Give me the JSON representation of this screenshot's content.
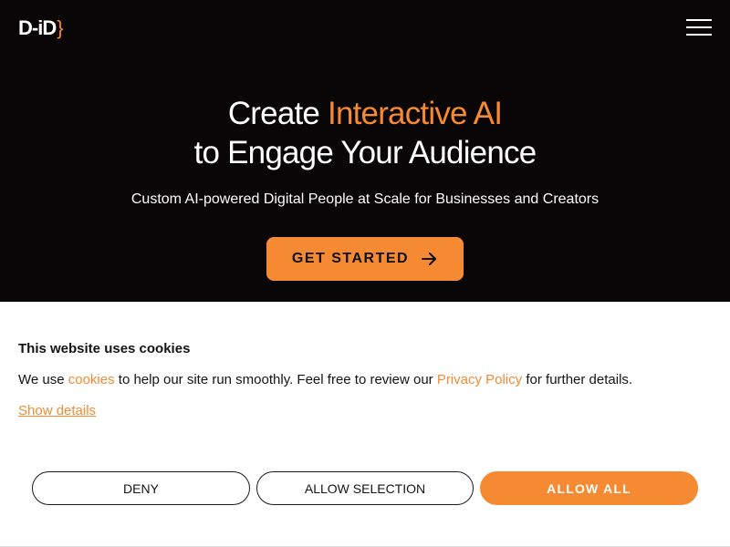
{
  "header": {
    "logo_text": "D-iD",
    "logo_brace": "}",
    "menu_icon": "hamburger-menu-icon"
  },
  "hero": {
    "title_prefix": "Create ",
    "title_accent": "Interactive AI",
    "title_line2": "to Engage Your Audience",
    "subtitle": "Custom AI-powered Digital People at Scale for Businesses and Creators",
    "cta_label": "GET STARTED",
    "cta_icon": "arrow-right-icon"
  },
  "cookie_banner": {
    "title": "This website uses cookies",
    "text_part1": "We use ",
    "cookies_link": "cookies",
    "text_part2": " to help our site run smoothly. Feel free to review our ",
    "privacy_link": "Privacy Policy",
    "text_part3": " for further details.",
    "show_details": "Show details",
    "deny_label": "DENY",
    "allow_selection_label": "ALLOW SELECTION",
    "allow_all_label": "ALLOW ALL"
  },
  "colors": {
    "accent": "#f58a32",
    "hero_background": "#080606",
    "banner_background": "#ffffff"
  }
}
